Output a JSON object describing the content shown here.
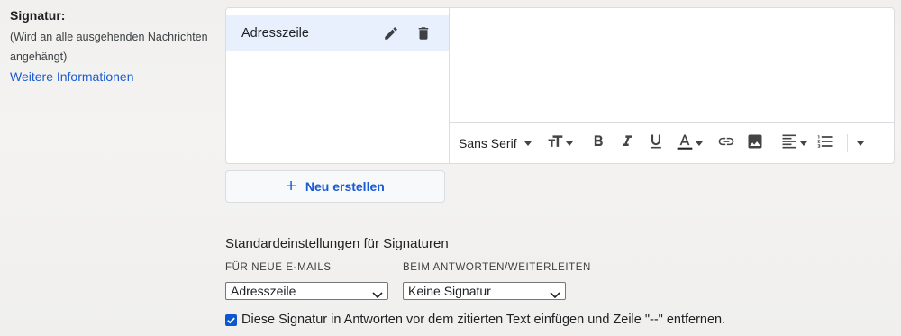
{
  "signature_section": {
    "title": "Signatur:",
    "hint": "(Wird an alle ausgehenden Nachrichten angehängt)",
    "more_info_link": "Weitere Informationen"
  },
  "signature_list": {
    "items": [
      {
        "label": "Adresszeile",
        "selected": true
      }
    ],
    "edit_icon": "pencil-icon",
    "delete_icon": "trash-icon"
  },
  "editor": {
    "content": "",
    "toolbar": {
      "font_family": "Sans Serif",
      "buttons": [
        "text-size-icon",
        "bold-icon",
        "italic-icon",
        "underline-icon",
        "text-color-icon",
        "link-icon",
        "image-icon",
        "align-icon",
        "numbered-list-icon",
        "more-options-icon"
      ]
    }
  },
  "new_button": {
    "icon": "plus-icon",
    "label": "Neu erstellen"
  },
  "defaults": {
    "title": "Standardeinstellungen für Signaturen",
    "new_emails": {
      "label": "FÜR NEUE E-MAILS",
      "selected": "Adresszeile"
    },
    "reply_forward": {
      "label": "BEIM ANTWORTEN/WEITERLEITEN",
      "selected": "Keine Signatur"
    },
    "insert_before_quote": {
      "checked": true,
      "label": "Diese Signatur in Antworten vor dem zitierten Text einfügen und Zeile \"--\" entfernen."
    }
  },
  "colors": {
    "accent": "#1a5bd1",
    "selected_row": "#e8f0fe",
    "checkbox": "#0b57d0"
  }
}
